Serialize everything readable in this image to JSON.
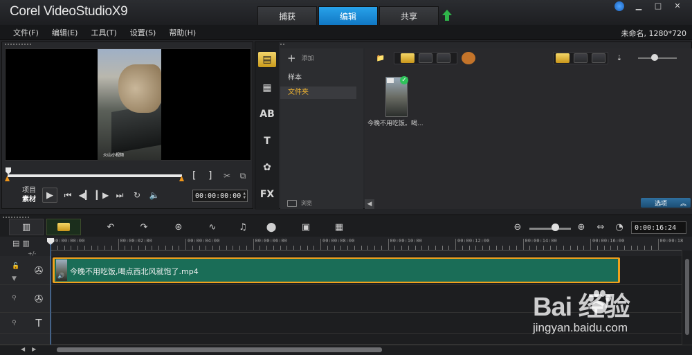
{
  "app": {
    "brand": "Corel",
    "product": "VideoStudio",
    "version": "X9"
  },
  "mode_tabs": [
    "捕获",
    "编辑",
    "共享"
  ],
  "active_mode": "编辑",
  "menu": [
    "文件(F)",
    "编辑(E)",
    "工具(T)",
    "设置(S)",
    "帮助(H)"
  ],
  "project_info": "未命名, 1280*720",
  "preview": {
    "video_watermark": "火山小视频",
    "bracket_in": "[",
    "bracket_out": "]",
    "mode_project": "项目",
    "mode_clip": "素材",
    "timecode": "00:00:00:00"
  },
  "library": {
    "add_label": "添加",
    "tree": [
      "样本",
      "文件夹"
    ],
    "selected_tree": "文件夹",
    "browse_label": "浏览",
    "thumbnail_label": "今晚不用吃饭。喝...",
    "options_label": "选项",
    "sidebar_icons": [
      "media-icon",
      "instant-project-icon",
      "transition-icon",
      "title-icon",
      "graphic-icon",
      "filter-icon"
    ],
    "fx_text": "FX"
  },
  "timeline": {
    "timecode": "0:00:16:24",
    "ruler": [
      "00:00:00:00",
      "00:00:02:00",
      "00:00:04:00",
      "00:00:06:00",
      "00:00:08:00",
      "00:00:10:00",
      "00:00:12:00",
      "00:00:14:00",
      "00:00:16:00",
      "00:00:18"
    ],
    "add_remove": "+/-",
    "clip_name": "今晚不用吃饭,喝点西北风就饱了.mp4",
    "zoom_level": 0.55
  },
  "watermark": {
    "brand": "Bai  经验",
    "site": "jingyan.baidu.com"
  },
  "colors": {
    "active_tab": "#1b8fdd",
    "clip": "#1a6d57",
    "clip_border": "#f1a11c",
    "accent_yellow": "#e6b52b"
  }
}
